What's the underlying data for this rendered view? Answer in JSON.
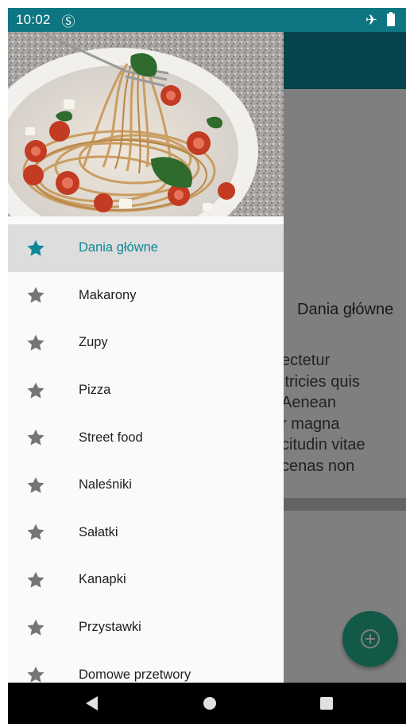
{
  "status_bar": {
    "time": "10:02",
    "sim_icon": "sim-card-icon",
    "airplane_icon": "airplane-icon",
    "battery_icon": "battery-full-icon"
  },
  "background": {
    "card_title": "Dania główne",
    "card_text_lines": [
      "ectetur",
      "ltricies quis",
      "Aenean",
      "r magna",
      "citudin vitae",
      "cenas non"
    ],
    "fab_icon": "add-circle-icon"
  },
  "drawer": {
    "header_image": "spaghetti-with-tomatoes-and-spinach",
    "items": [
      {
        "label": "Dania główne",
        "icon": "star-icon",
        "active": true
      },
      {
        "label": "Makarony",
        "icon": "star-icon"
      },
      {
        "label": "Zupy",
        "icon": "star-icon"
      },
      {
        "label": "Pizza",
        "icon": "star-icon"
      },
      {
        "label": "Street food",
        "icon": "star-icon"
      },
      {
        "label": "Naleśniki",
        "icon": "star-icon"
      },
      {
        "label": "Sałatki",
        "icon": "star-icon"
      },
      {
        "label": "Kanapki",
        "icon": "star-icon"
      },
      {
        "label": "Przystawki",
        "icon": "star-icon"
      },
      {
        "label": "Domowe przetwory",
        "icon": "star-icon"
      }
    ]
  },
  "colors": {
    "primary": "#0e8798",
    "status_bar": "#0e7582",
    "accent": "#25b291",
    "active_item_bg": "#dddddd",
    "star_inactive": "#757575"
  },
  "nav_bar": {
    "back_icon": "back-triangle-icon",
    "home_icon": "home-circle-icon",
    "recents_icon": "recents-square-icon"
  }
}
